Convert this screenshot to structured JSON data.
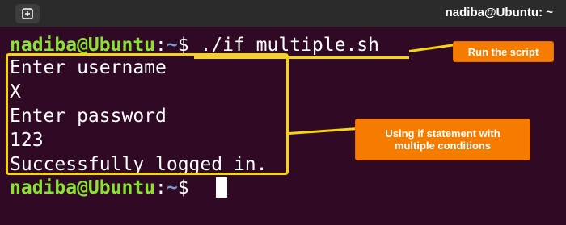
{
  "window": {
    "title": "nadiba@Ubuntu: ~"
  },
  "prompt": {
    "user": "nadiba@Ubuntu",
    "sep": ":",
    "path": "~",
    "symbol": "$"
  },
  "terminal": {
    "command": " ./if_multiple.sh",
    "output": [
      "Enter username",
      "X",
      "Enter password",
      "123",
      "Successfully logged in."
    ]
  },
  "annotations": {
    "run_label": "Run the script",
    "cond_label_line1": "Using if statement with",
    "cond_label_line2": "multiple conditions",
    "highlight_color": "#f6d40f",
    "label_color": "#f57c00"
  },
  "colors": {
    "background": "#300a24",
    "prompt_user": "#8ae234",
    "prompt_path": "#729fcf"
  }
}
